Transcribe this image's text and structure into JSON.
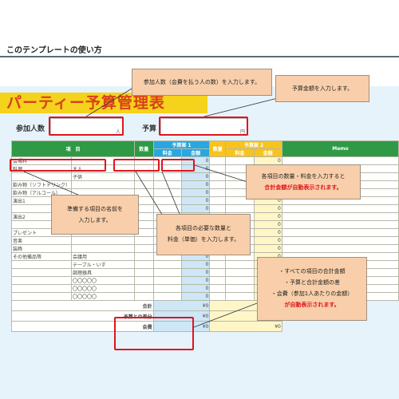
{
  "page": {
    "heading": "このテンプレートの使い方"
  },
  "sheet": {
    "title": "パーティー予算管理表",
    "participants_label": "参加人数",
    "participants_unit": "人",
    "budget_label": "予算",
    "budget_unit": "円"
  },
  "table": {
    "header": {
      "item": "項　目",
      "qty": "数量",
      "plan1": "予算案 1",
      "plan2": "予算案 2",
      "price": "料金",
      "amount": "金額",
      "memo": "Memo"
    },
    "rows": [
      {
        "cat": "会場料",
        "sub": "",
        "a1": "0",
        "a2": "0"
      },
      {
        "cat": "料理",
        "sub": "大人",
        "a1": "0",
        "a2": "0"
      },
      {
        "cat": "",
        "sub": "子供",
        "a1": "0",
        "a2": "0"
      },
      {
        "cat": "飲み物（ソフトドリンク）",
        "sub": "",
        "a1": "0",
        "a2": "0"
      },
      {
        "cat": "飲み物（アルコール）",
        "sub": "",
        "a1": "0",
        "a2": "0"
      },
      {
        "cat": "演出1",
        "sub": "",
        "a1": "0",
        "a2": "0"
      },
      {
        "cat": "",
        "sub": "",
        "a1": "0",
        "a2": "0"
      },
      {
        "cat": "演出2",
        "sub": "",
        "a1": "0",
        "a2": "0"
      },
      {
        "cat": "",
        "sub": "",
        "a1": "0",
        "a2": "0"
      },
      {
        "cat": "プレゼント",
        "sub": "",
        "a1": "0",
        "a2": "0"
      },
      {
        "cat": "音楽",
        "sub": "",
        "a1": "0",
        "a2": "0"
      },
      {
        "cat": "装飾",
        "sub": "",
        "a1": "0",
        "a2": "0"
      },
      {
        "cat": "その他備品等",
        "sub": "会議用",
        "a1": "0",
        "a2": "0"
      },
      {
        "cat": "",
        "sub": "テーブル・いす",
        "a1": "0",
        "a2": "0"
      },
      {
        "cat": "",
        "sub": "調理器具",
        "a1": "0",
        "a2": "0"
      },
      {
        "cat": "",
        "sub": "〇〇〇〇〇",
        "a1": "0",
        "a2": "0"
      },
      {
        "cat": "",
        "sub": "〇〇〇〇〇",
        "a1": "0",
        "a2": "0"
      },
      {
        "cat": "",
        "sub": "〇〇〇〇〇",
        "a1": "0",
        "a2": "0"
      }
    ],
    "totals": [
      {
        "label": "合計",
        "v1": "¥0",
        "v2": "¥0"
      },
      {
        "label": "予算との差分",
        "v1": "¥0",
        "v2": "¥0"
      },
      {
        "label": "会費",
        "v1": "¥0",
        "v2": "¥0"
      }
    ]
  },
  "callouts": {
    "participants": "参加人数（会費を払う人の数）を入力します。",
    "budget": "予算金額を入力します。",
    "auto_line1": "各項目の数量・料金を入力すると",
    "auto_line2": "合計金額が自動表示されます。",
    "item_line1": "準備する項目の名前を",
    "item_line2": "入力します。",
    "qty_line1": "各項目の必要な数量と",
    "qty_line2": "料金（単価）を入力します。",
    "totals_line1": "・すべての項目の合計金額",
    "totals_line2": "・予算と合計金額の差",
    "totals_line3": "・会費（参加1人あたりの金額）",
    "totals_line4": "が自動表示されます。"
  },
  "colors": {
    "accent_red": "#e0141e",
    "title_yellow": "#f5d21b",
    "header_green": "#2e9a45",
    "header_blue": "#28a7e1",
    "header_yellow": "#f7c31c"
  }
}
